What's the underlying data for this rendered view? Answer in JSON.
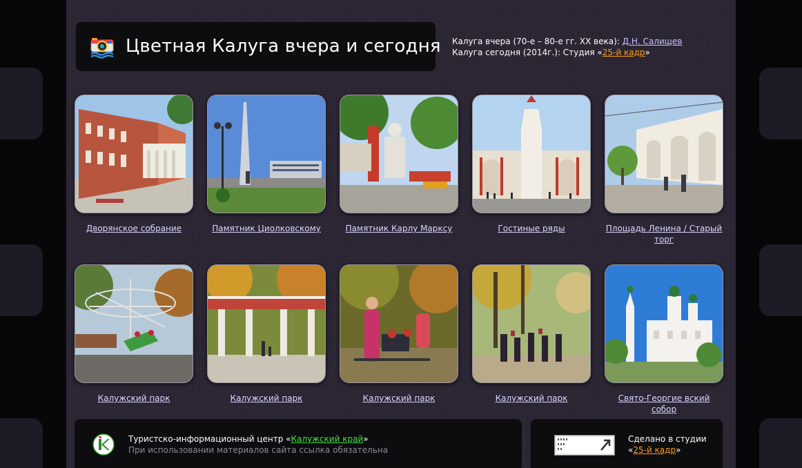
{
  "header": {
    "title": "Цветная Калуга вчера и сегодня",
    "yesterday_prefix": "Калуга вчера (70-е – 80-е гг. XX века): ",
    "yesterday_author": "Д.Н. Салищев",
    "today_prefix": "Калуга сегодня (2014г.): Студия «",
    "today_studio": "25-й кадр",
    "today_suffix": "»"
  },
  "gallery": {
    "items": [
      {
        "caption": "Дворянское собрание"
      },
      {
        "caption": "Памятник Циолковскому"
      },
      {
        "caption": "Памятник Карлу Марксу"
      },
      {
        "caption": "Гостиные ряды"
      },
      {
        "caption": "Площадь Ленина / Старый торг"
      },
      {
        "caption": "Калужский парк"
      },
      {
        "caption": "Калужский парк"
      },
      {
        "caption": "Калужский парк"
      },
      {
        "caption": "Калужский парк"
      },
      {
        "caption": "Свято-Георгие вский собор"
      }
    ]
  },
  "footer": {
    "info_prefix": "Туристско-информационный центр «",
    "info_link": "Калужский край",
    "info_suffix": "»",
    "notice": "При использовании материалов сайта ссылка обязательна",
    "made_line1": "Сделано в студии",
    "made_prefix": "«",
    "made_link": "25-й кадр",
    "made_suffix": "»"
  }
}
